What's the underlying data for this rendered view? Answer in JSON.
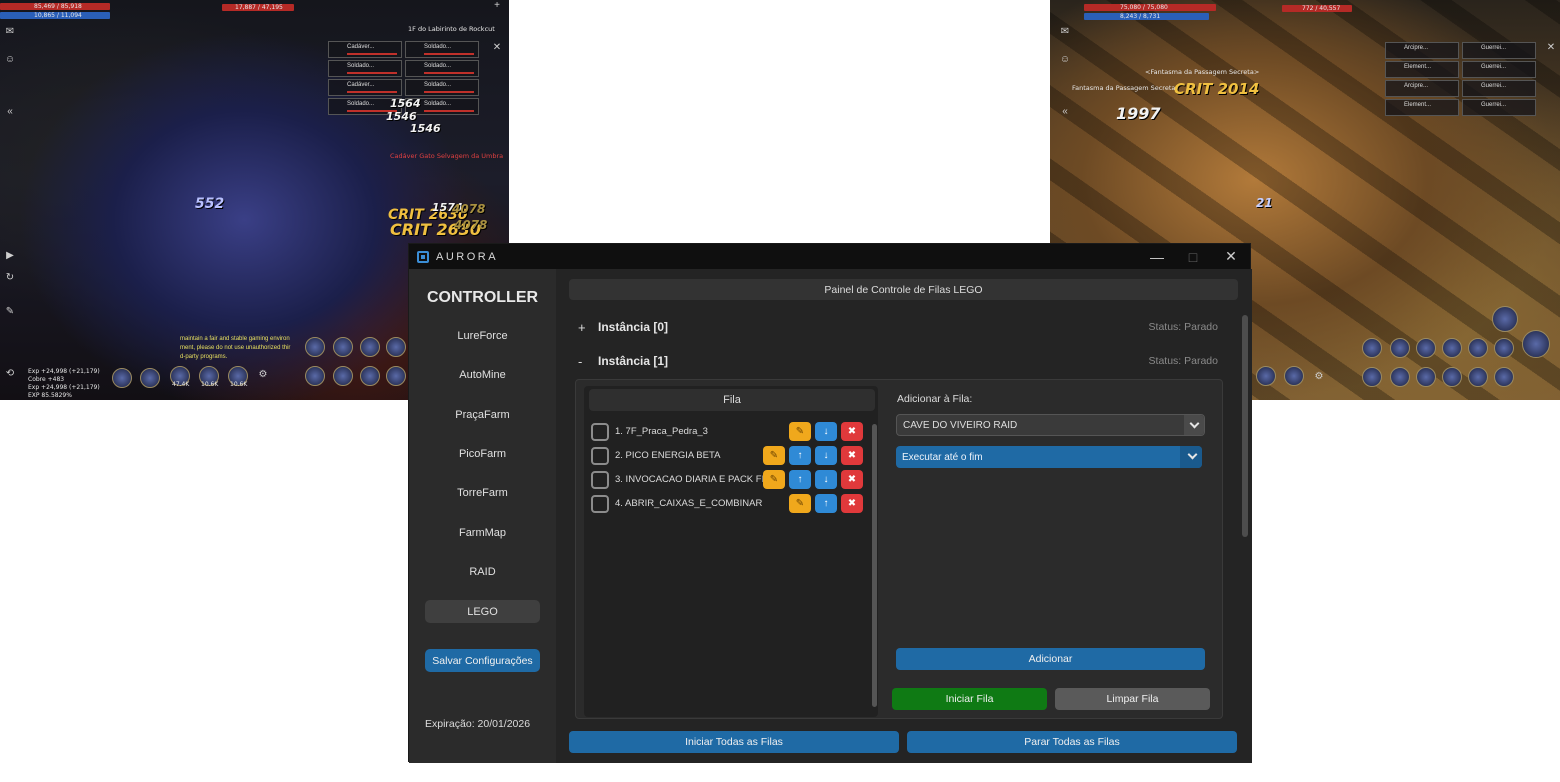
{
  "game_left": {
    "hp_text": "85,469 / 85,918",
    "mp_text": "10,865 / 11,094",
    "target_hp": "17,887 / 47,195",
    "location": "1F do Labirinto de Rockcut",
    "party": [
      "Cadáver...",
      "Soldado...",
      "Soldado...",
      "Soldado...",
      "Cadáver...",
      "Soldado...",
      "Soldado...",
      "Soldado..."
    ],
    "enemy_name": "Cadáver Gato Selvagem da Umbra",
    "damage": [
      "552",
      "1564",
      "1546",
      "1546",
      "CRIT 2630",
      "CRIT 2630",
      "1574",
      "4078",
      "4078"
    ],
    "chat": [
      "maintain a fair and stable gaming environ",
      "ment, please do not use unauthorized thir",
      "d-party programs."
    ],
    "exp": [
      "Exp +24,998 (+21,179)",
      "Cobre +483",
      "Exp +24,998 (+21,179)",
      "EXP  85.5829%"
    ],
    "skill_counts": [
      "47.4K",
      "10.6K",
      "10.6K"
    ]
  },
  "game_right": {
    "hp_text": "75,080 / 75,080",
    "mp_text": "8,243 / 8,731",
    "target_hp": "772 / 40,557",
    "party": [
      "Arcipre...",
      "Guerrei...",
      "Element...",
      "Guerrei...",
      "Arcipre...",
      "Guerrei...",
      "Element...",
      "Guerrei..."
    ],
    "enemy_name": "<Fantasma da Passagem Secreta>",
    "enemy_name2": "Fantasma da Passagem Secreta",
    "damage": [
      "1997",
      "CRIT 2014",
      "21"
    ]
  },
  "window": {
    "title": "AURORA",
    "minimize": "—",
    "maximize": "□",
    "close": "✕"
  },
  "sidebar": {
    "title": "CONTROLLER",
    "items": [
      "LureForce",
      "AutoMine",
      "PraçaFarm",
      "PicoFarm",
      "TorreFarm",
      "FarmMap",
      "RAID",
      "LEGO"
    ],
    "active": "LEGO",
    "save_label": "Salvar Configurações",
    "expiry": "Expiração: 20/01/2026"
  },
  "main": {
    "header": "Painel de Controle de Filas LEGO",
    "instances": [
      {
        "toggle": "+",
        "name": "Instância [0]",
        "status": "Status: Parado",
        "expanded": false
      },
      {
        "toggle": "-",
        "name": "Instância [1]",
        "status": "Status: Parado",
        "expanded": true
      }
    ],
    "queue": {
      "header": "Fila",
      "items": [
        {
          "label": "1. 7F_Praca_Pedra_3",
          "has_up": false,
          "has_down": true
        },
        {
          "label": "2. PICO ENERGIA BETA",
          "has_up": true,
          "has_down": true
        },
        {
          "label": "3. INVOCACAO DIARIA E PACK FI",
          "has_up": true,
          "has_down": true
        },
        {
          "label": "4. ABRIR_CAIXAS_E_COMBINAR",
          "has_up": true,
          "has_down": false
        }
      ],
      "icons": {
        "edit": "✎",
        "up": "↑",
        "down": "↓",
        "delete": "✖"
      }
    },
    "add": {
      "label": "Adicionar à Fila:",
      "raid_value": "CAVE DO VIVEIRO RAID",
      "mode_value": "Executar até o fim",
      "add_button": "Adicionar",
      "start_button": "Iniciar Fila",
      "clear_button": "Limpar Fila"
    },
    "start_all": "Iniciar Todas as Filas",
    "stop_all": "Parar Todas as Filas"
  },
  "colors": {
    "accent_blue": "#1f6aa5",
    "start_green": "#0f7a14",
    "edit_orange": "#f0a81c",
    "move_blue": "#2f8ad6",
    "delete_red": "#e0393b"
  }
}
